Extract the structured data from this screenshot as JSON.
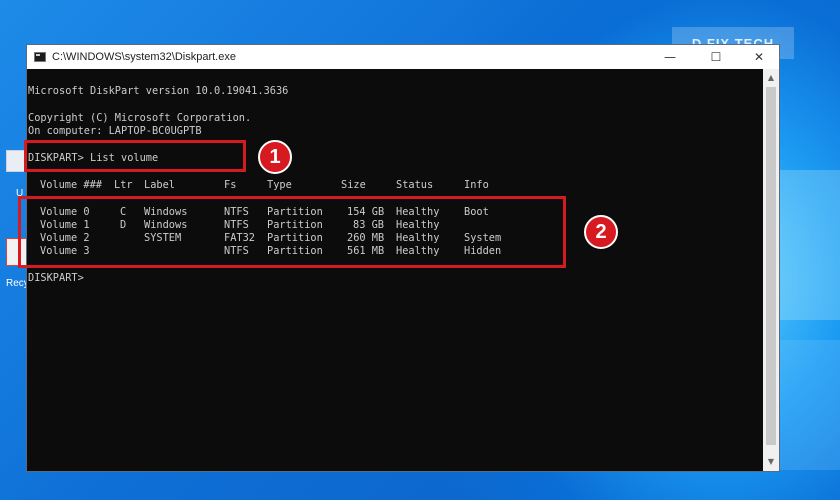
{
  "window": {
    "title": "C:\\WINDOWS\\system32\\Diskpart.exe",
    "minimize_glyph": "—",
    "maximize_glyph": "☐",
    "close_glyph": "✕"
  },
  "console": {
    "version_line": "Microsoft DiskPart version 10.0.19041.3636",
    "copyright_line": "Copyright (C) Microsoft Corporation.",
    "computer_line": "On computer: LAPTOP-BC0UGPTB",
    "command_line": "DISKPART> List volume",
    "prompt_line": "DISKPART>",
    "columns": [
      "Volume ###",
      "Ltr",
      "Label",
      "Fs",
      "Type",
      "Size",
      "Status",
      "Info"
    ],
    "volumes": [
      {
        "volume": "Volume 0",
        "ltr": "C",
        "label": "Windows",
        "fs": "NTFS",
        "type": "Partition",
        "size": "154 GB",
        "status": "Healthy",
        "info": "Boot"
      },
      {
        "volume": "Volume 1",
        "ltr": "D",
        "label": "Windows",
        "fs": "NTFS",
        "type": "Partition",
        "size": "83 GB",
        "status": "Healthy",
        "info": ""
      },
      {
        "volume": "Volume 2",
        "ltr": "",
        "label": "SYSTEM",
        "fs": "FAT32",
        "type": "Partition",
        "size": "260 MB",
        "status": "Healthy",
        "info": "System"
      },
      {
        "volume": "Volume 3",
        "ltr": "",
        "label": "",
        "fs": "NTFS",
        "type": "Partition",
        "size": "561 MB",
        "status": "Healthy",
        "info": "Hidden"
      }
    ]
  },
  "annotations": {
    "badge_1": "1",
    "badge_2": "2",
    "highlight_color": "#d71920"
  },
  "desktop": {
    "partial_label_1": "U",
    "partial_label_2": "Recy",
    "watermark_text": "D   FIX TECH"
  },
  "colors": {
    "console_bg": "#0c0c0c",
    "console_text": "#cccccc",
    "desktop_blue": "#0e6fd6"
  }
}
